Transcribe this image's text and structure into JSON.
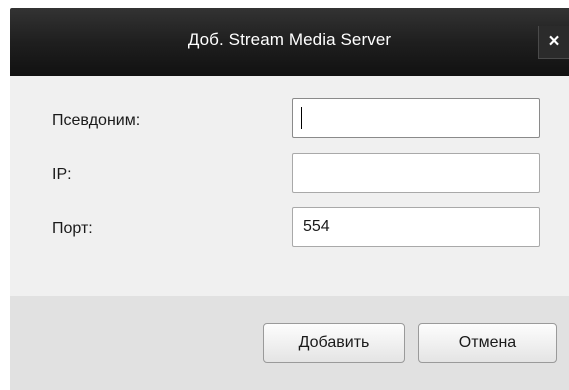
{
  "dialog": {
    "title": "Доб. Stream Media Server",
    "close_label": "×"
  },
  "form": {
    "alias_label": "Псевдоним:",
    "alias_value": "",
    "ip_label": "IP:",
    "ip_value": "",
    "port_label": "Порт:",
    "port_value": "554"
  },
  "footer": {
    "add_label": "Добавить",
    "cancel_label": "Отмена"
  }
}
